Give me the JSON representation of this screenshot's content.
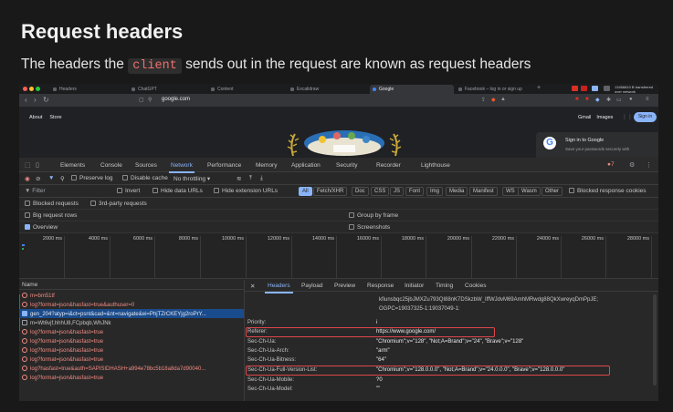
{
  "heading": "Request headers",
  "subtitle": {
    "before": "The headers the ",
    "code": "client",
    "after": " sends out in the request are known as request headers"
  },
  "browser": {
    "tabs": [
      {
        "label": "Headers",
        "active": false
      },
      {
        "label": "ChatGPT",
        "active": false
      },
      {
        "label": "Content",
        "active": false
      },
      {
        "label": "Excalidraw",
        "active": false
      },
      {
        "label": "Google",
        "active": true
      },
      {
        "label": "Facebook – log in or sign up",
        "active": false
      }
    ],
    "new_tab": "+",
    "download_text": "13456810 B transferred over network",
    "url": "google.com",
    "google": {
      "left_links": [
        "About",
        "Store"
      ],
      "right_links": [
        "Gmail",
        "Images"
      ],
      "sign_in": "Sign in",
      "popup_title": "Sign in to Google",
      "popup_text": "Save your passwords securely with"
    }
  },
  "devtools": {
    "tabs": [
      "Elements",
      "Console",
      "Sources",
      "Network",
      "Performance",
      "Memory",
      "Application",
      "Security",
      "Recorder",
      "Lighthouse"
    ],
    "active_tab": "Network",
    "error_count": "7",
    "toolbar": {
      "preserve_log": "Preserve log",
      "disable_cache": "Disable cache",
      "throttling": "No throttling"
    },
    "filter": {
      "placeholder": "Filter",
      "invert": "Invert",
      "hide_data_urls": "Hide data URLs",
      "hide_ext_urls": "Hide extension URLs",
      "types": [
        "All",
        "Fetch/XHR",
        "Doc",
        "CSS",
        "JS",
        "Font",
        "Img",
        "Media",
        "Manifest",
        "WS",
        "Wasm",
        "Other"
      ],
      "blocked_response": "Blocked response cookies"
    },
    "options": {
      "blocked_requests": "Blocked requests",
      "third_party": "3rd-party requests",
      "big_rows": "Big request rows",
      "group_by_frame": "Group by frame",
      "overview": "Overview",
      "screenshots": "Screenshots"
    },
    "timeline_ticks": [
      "2000 ms",
      "4000 ms",
      "6000 ms",
      "8000 ms",
      "10000 ms",
      "12000 ms",
      "14000 ms",
      "16000 ms",
      "18000 ms",
      "20000 ms",
      "22000 ms",
      "24000 ms",
      "26000 ms",
      "28000 ms"
    ],
    "list_header": "Name",
    "requests": [
      {
        "name": "m=bm51tf",
        "kind": "err"
      },
      {
        "name": "log?format=json&hasfast=true&authuser=0",
        "kind": "err"
      },
      {
        "name": "gen_204?atyp=i&ct=psnt&cad=&nt=navigate&ei=PhjTZrCKEYjg2roPrY...",
        "kind": "sel"
      },
      {
        "name": "m=Wt6vjf,hhhU8,FCpbqb,WhJNk",
        "kind": "doc"
      },
      {
        "name": "log?format=json&hasfast=true",
        "kind": "err"
      },
      {
        "name": "log?format=json&hasfast=true",
        "kind": "err"
      },
      {
        "name": "log?format=json&hasfast=true",
        "kind": "err"
      },
      {
        "name": "log?format=json&hasfast=true",
        "kind": "err"
      },
      {
        "name": "log?hasfast=true&auth=SAPISIDHASH+a994e78bc5b18a8da7d90040...",
        "kind": "err"
      },
      {
        "name": "log?format=json&hasfast=true",
        "kind": "err"
      }
    ],
    "detail_tabs": [
      "Headers",
      "Payload",
      "Preview",
      "Response",
      "Initiator",
      "Timing",
      "Cookies"
    ],
    "detail_active": "Headers",
    "value_lines": [
      "kfiunsbqc25jbJMXZu793QI88nK7DSkzbW_IffWJdvM69AmhMRwdg88QkXwreyqDmPpJE;",
      "OGPC=19037325-1:19037049-1:"
    ],
    "headers": [
      {
        "key": "Priority:",
        "value": "i"
      },
      {
        "key": "Referer:",
        "value": "https://www.google.com/"
      },
      {
        "key": "Sec-Ch-Ua:",
        "value": "\"Chromium\";v=\"128\", \"Not;A=Brand\";v=\"24\", \"Brave\";v=\"128\""
      },
      {
        "key": "Sec-Ch-Ua-Arch:",
        "value": "\"arm\""
      },
      {
        "key": "Sec-Ch-Ua-Bitness:",
        "value": "\"64\""
      },
      {
        "key": "Sec-Ch-Ua-Full-Version-List:",
        "value": "\"Chromium\";v=\"128.0.0.0\", \"Not;A=Brand\";v=\"24.0.0.0\", \"Brave\";v=\"128.0.0.0\""
      },
      {
        "key": "Sec-Ch-Ua-Mobile:",
        "value": "?0"
      },
      {
        "key": "Sec-Ch-Ua-Model:",
        "value": "\"\""
      }
    ]
  },
  "colors": {
    "accent": "#8ab4f8",
    "error": "#f28b82",
    "highlight": "#e0474c",
    "code": "#ef6f6c"
  }
}
